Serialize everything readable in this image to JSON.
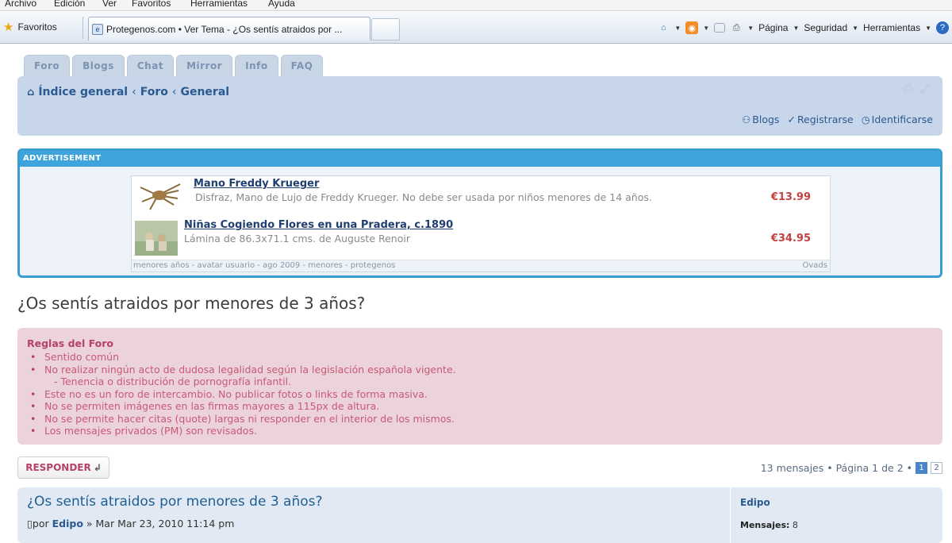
{
  "browser": {
    "menu": [
      "Archivo",
      "Edición",
      "Ver",
      "Favoritos",
      "Herramientas",
      "Ayuda"
    ],
    "favorites_label": "Favoritos",
    "tab_title": "Protegenos.com • Ver Tema - ¿Os sentís atraidos por ...",
    "commands": {
      "page": "Página",
      "security": "Seguridad",
      "tools": "Herramientas"
    }
  },
  "site": {
    "nav_tabs": [
      "Foro",
      "Blogs",
      "Chat",
      "Mirror",
      "Info",
      "FAQ"
    ],
    "breadcrumb": [
      "Índice general",
      "Foro",
      "General"
    ],
    "user_links": {
      "blogs": "Blogs",
      "register": "Registrarse",
      "login": "Identificarse"
    }
  },
  "ad": {
    "header": "ADVERTISEMENT",
    "items": [
      {
        "title": "Mano Freddy Krueger",
        "desc": "Disfraz, Mano de Lujo de Freddy Krueger. No debe ser usada por niños menores de 14 años.",
        "price": "€13.99"
      },
      {
        "title": "Niñas Cogiendo Flores en una Pradera, c.1890",
        "desc": "Lámina de 86.3x71.1 cms. de Auguste Renoir",
        "price": "€34.95"
      }
    ],
    "footer": "menores años - avatar usuario - ago 2009 - menores - protegenos",
    "footer_brand": "Ovads"
  },
  "topic": {
    "title": "¿Os sentís atraidos por menores de 3 años?"
  },
  "rules": {
    "title": "Reglas del Foro",
    "items": [
      "Sentido común",
      "No realizar ningún acto de dudosa legalidad según la legislación española vigente.",
      "- Tenencia o distribución de pornografía infantil.",
      "Este no es un foro de intercambio. No publicar fotos o links de forma masiva.",
      "No se permiten imágenes en las firmas mayores a 115px de altura.",
      "No se permite hacer citas (quote) largas ni responder en el interior de los mismos.",
      "Los mensajes privados (PM) son revisados."
    ]
  },
  "actions": {
    "reply_label": "RESPONDER"
  },
  "pagination": {
    "summary": "13 mensajes • Página 1 de 2 •",
    "pages": [
      "1",
      "2"
    ]
  },
  "post": {
    "title": "¿Os sentís atraidos por menores de 3 años?",
    "meta_prefix": "por",
    "author": "Edipo",
    "meta_date": "» Mar Mar 23, 2010 11:14 pm",
    "side_author": "Edipo",
    "messages_label": "Mensajes:",
    "messages_value": "8"
  },
  "colors": {
    "link_blue": "#2a5a90",
    "ad_blue": "#3ea4db",
    "rules_pink": "#ecd2da",
    "price_red": "#c24242"
  }
}
